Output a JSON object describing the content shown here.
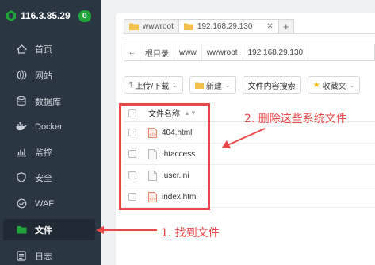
{
  "server": {
    "ip": "116.3.85.29",
    "badge": "0"
  },
  "sidebar": {
    "items": [
      {
        "label": "首页",
        "icon": "home-icon"
      },
      {
        "label": "网站",
        "icon": "globe-icon"
      },
      {
        "label": "数据库",
        "icon": "database-icon"
      },
      {
        "label": "Docker",
        "icon": "docker-icon"
      },
      {
        "label": "监控",
        "icon": "monitor-icon"
      },
      {
        "label": "安全",
        "icon": "shield-icon"
      },
      {
        "label": "WAF",
        "icon": "waf-icon"
      },
      {
        "label": "文件",
        "icon": "folder-icon",
        "active": true
      },
      {
        "label": "日志",
        "icon": "log-icon"
      }
    ]
  },
  "tabs": [
    {
      "label": "wwwroot"
    },
    {
      "label": "192.168.29.130",
      "active": true
    }
  ],
  "address": {
    "crumbs": [
      "根目录",
      "www",
      "wwwroot",
      "192.168.29.130"
    ]
  },
  "toolbar": {
    "upload": "上传/下载",
    "new": "新建",
    "search_content": "文件内容搜索",
    "favorites": "收藏夹"
  },
  "table": {
    "header": "文件名称",
    "files": [
      {
        "name": "404.html",
        "type": "html"
      },
      {
        "name": ".htaccess",
        "type": "file"
      },
      {
        "name": ".user.ini",
        "type": "file"
      },
      {
        "name": "index.html",
        "type": "html"
      }
    ]
  },
  "annotations": {
    "note1": "1. 找到文件",
    "note2": "2. 删除这些系统文件",
    "color": "#e94848"
  },
  "colors": {
    "accent": "#20a53a",
    "sidebar": "#2b3643"
  }
}
